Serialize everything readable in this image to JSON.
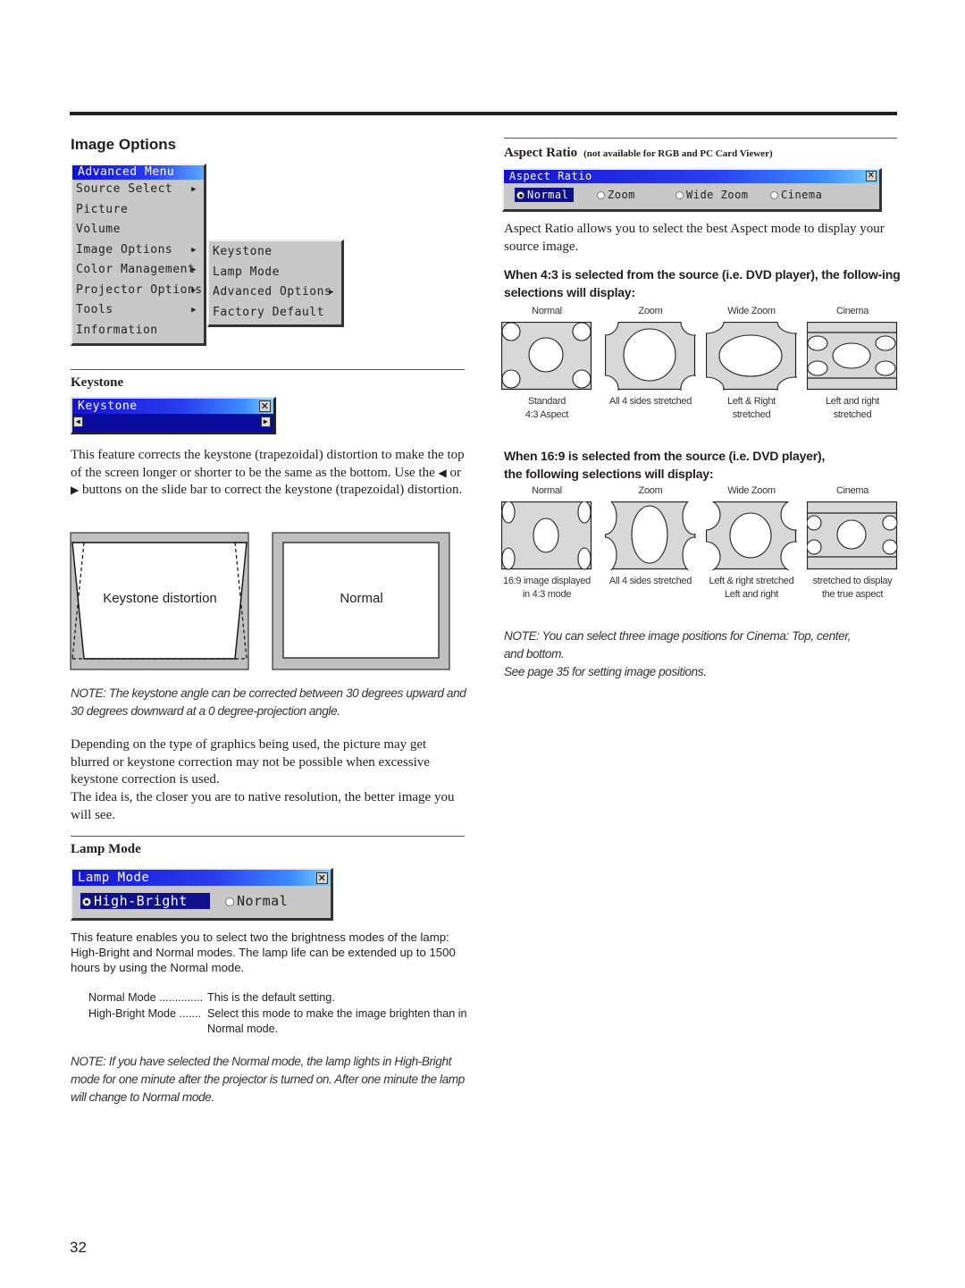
{
  "page": {
    "number": "32"
  },
  "image_options": {
    "heading": "Image Options",
    "advanced_menu": {
      "title": "Advanced Menu",
      "items": [
        {
          "label": "Source Select",
          "has_submenu": true
        },
        {
          "label": "Picture",
          "has_submenu": false
        },
        {
          "label": "Volume",
          "has_submenu": false
        },
        {
          "label": "Image Options",
          "has_submenu": true
        },
        {
          "label": "Color Management",
          "has_submenu": true
        },
        {
          "label": "Projector Options",
          "has_submenu": true
        },
        {
          "label": "Tools",
          "has_submenu": true
        },
        {
          "label": "Information",
          "has_submenu": false
        }
      ]
    },
    "submenu": {
      "items": [
        {
          "label": "Keystone",
          "has_submenu": false
        },
        {
          "label": "Lamp Mode",
          "has_submenu": false
        },
        {
          "label": "Advanced Options",
          "has_submenu": true
        },
        {
          "label": "Factory Default",
          "has_submenu": false
        }
      ]
    },
    "arrow_glyph": "▶"
  },
  "keystone": {
    "heading": "Keystone",
    "dialog_title": "Keystone",
    "close_glyph": "✕",
    "left_glyph": "◀",
    "right_glyph": "▶",
    "body_before": "This feature corrects the keystone (trapezoidal) distortion to make the top of the screen longer or shorter to be the same as the bottom. Use the ",
    "body_left_glyph": "◀",
    "body_mid": " or ",
    "body_right_glyph": "▶",
    "body_after": " buttons on the slide bar to correct the keystone (trapezoidal) distortion.",
    "diagram_distortion_label": "Keystone distortion",
    "diagram_normal_label": "Normal",
    "note": "NOTE: The keystone angle can be corrected between 30 degrees upward and 30 degrees downward at a 0 degree-projection angle.",
    "para2_line1": "Depending on the type of graphics being used, the picture may get blurred or keystone correction may not be possible when excessive keystone correction is used.",
    "para2_line2": "The idea is, the closer you are to native resolution, the better image you will see."
  },
  "lamp_mode": {
    "heading": "Lamp Mode",
    "dialog_title": "Lamp Mode",
    "options": [
      {
        "label": "High-Bright",
        "selected": true
      },
      {
        "label": "Normal",
        "selected": false
      }
    ],
    "body": "This feature enables you to select two the brightness modes of the lamp: High-Bright and Normal modes. The lamp life can be extended up to 1500 hours by using the Normal mode.",
    "definitions": [
      {
        "term": "Normal Mode ..............",
        "desc": "This is the default setting."
      },
      {
        "term": "High-Bright Mode .......",
        "desc": "Select this mode to make the image brighten than in Normal mode."
      }
    ],
    "note": "NOTE: If you have selected the Normal mode, the lamp lights in High-Bright mode for one minute after the projector is turned on. After one minute the lamp will change to Normal mode."
  },
  "aspect_ratio": {
    "heading": "Aspect Ratio",
    "heading_qualifier": "(not available for RGB and PC Card Viewer)",
    "dialog_title": "Aspect Ratio",
    "options": [
      {
        "label": "Normal",
        "selected": true
      },
      {
        "label": "Zoom",
        "selected": false
      },
      {
        "label": "Wide Zoom",
        "selected": false
      },
      {
        "label": "Cinema",
        "selected": false
      }
    ],
    "body": "Aspect Ratio allows you to select the best Aspect mode to display your source image.",
    "source_4_3": {
      "heading": "When 4:3 is selected from the source (i.e. DVD player), the follow-ing selections will display:",
      "panels": [
        {
          "title": "Normal",
          "caption": [
            "Standard",
            "4:3 Aspect"
          ]
        },
        {
          "title": "Zoom",
          "caption": [
            "All 4 sides stretched"
          ]
        },
        {
          "title": "Wide Zoom",
          "caption": [
            "Left & Right",
            "stretched"
          ]
        },
        {
          "title": "Cinema",
          "caption": [
            "Left and right",
            "stretched"
          ]
        }
      ]
    },
    "source_16_9": {
      "heading_line1": "When 16:9 is selected from the source (i.e. DVD player),",
      "heading_line2": "the following selections will display:",
      "panels": [
        {
          "title": "Normal",
          "caption": [
            "16:9 image displayed",
            "in 4:3 mode"
          ]
        },
        {
          "title": "Zoom",
          "caption": [
            "All 4 sides stretched"
          ]
        },
        {
          "title": "Wide Zoom",
          "caption": [
            "Left & right stretched",
            "Left and right"
          ]
        },
        {
          "title": "Cinema",
          "caption": [
            "stretched to display",
            "the true aspect"
          ]
        }
      ]
    },
    "note_line1": "NOTE: You can select three image positions for Cinema: Top, center,",
    "note_line2": "and bottom.",
    "note_line3": "See page 35 for setting image positions."
  }
}
